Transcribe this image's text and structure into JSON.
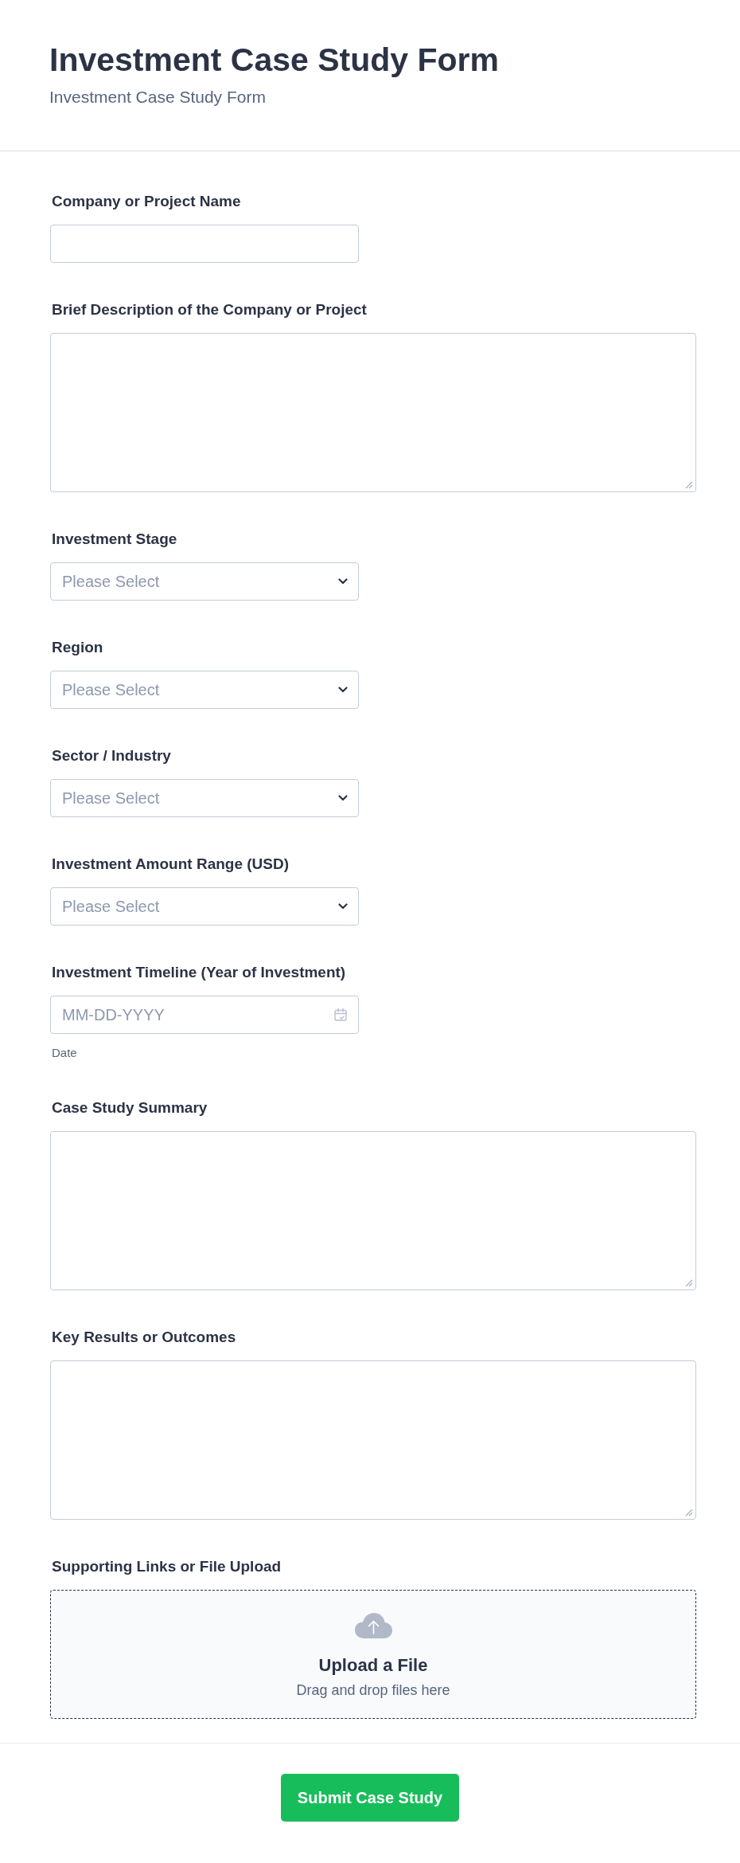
{
  "header": {
    "title": "Investment Case Study Form",
    "subtitle": "Investment Case Study Form"
  },
  "fields": [
    {
      "kind": "text",
      "label": "Company or Project Name"
    },
    {
      "kind": "textarea",
      "label": "Brief Description of the Company or Project"
    },
    {
      "kind": "select",
      "label": "Investment Stage",
      "placeholder": "Please Select"
    },
    {
      "kind": "select",
      "label": "Region",
      "placeholder": "Please Select"
    },
    {
      "kind": "select",
      "label": "Sector / Industry",
      "placeholder": "Please Select"
    },
    {
      "kind": "select",
      "label": "Investment Amount Range (USD)",
      "placeholder": "Please Select"
    },
    {
      "kind": "date",
      "label": "Investment Timeline (Year of Investment)",
      "placeholder": "MM-DD-YYYY",
      "sublabel": "Date"
    },
    {
      "kind": "textarea",
      "label": "Case Study Summary"
    },
    {
      "kind": "textarea",
      "label": "Key Results or Outcomes"
    },
    {
      "kind": "upload",
      "label": "Supporting Links or File Upload",
      "title": "Upload a File",
      "hint": "Drag and drop files here"
    }
  ],
  "submit_button": {
    "label": "Submit Case Study"
  }
}
